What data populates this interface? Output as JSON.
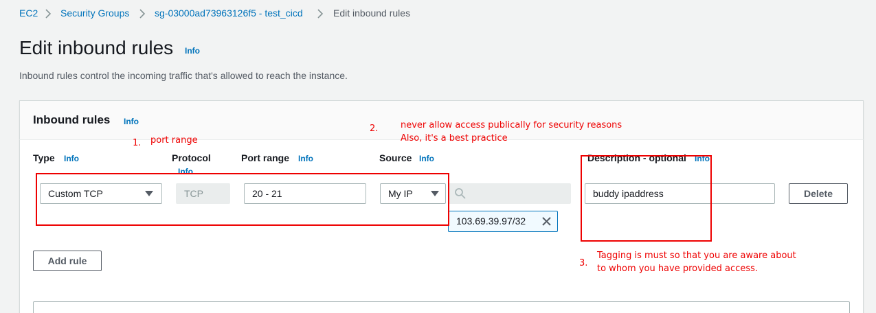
{
  "breadcrumb": {
    "items": [
      "EC2",
      "Security Groups",
      "sg-03000ad73963126f5 - test_cicd"
    ],
    "current": "Edit inbound rules"
  },
  "page": {
    "title": "Edit inbound rules",
    "info": "Info",
    "description": "Inbound rules control the incoming traffic that's allowed to reach the instance."
  },
  "panel": {
    "title": "Inbound rules",
    "info": "Info",
    "columns": {
      "type": "Type",
      "protocol": "Protocol",
      "port_range": "Port range",
      "source": "Source",
      "description": "Description - optional",
      "info": "Info"
    },
    "rule": {
      "type": "Custom TCP",
      "protocol": "TCP",
      "port_range": "20 - 21",
      "source_type": "My IP",
      "source_token": "103.69.39.97/32",
      "description": "buddy ipaddress",
      "delete_label": "Delete"
    },
    "add_rule_label": "Add rule"
  },
  "annotations": {
    "n1": "1.",
    "t1": "port range",
    "n2": "2.",
    "t2a": "never allow access publically for security reasons",
    "t2b": "Also, it's a best practice",
    "n3": "3.",
    "t3a": "Tagging is must so that you are aware about",
    "t3b": "to whom you have provided access.",
    "color": "#e00000"
  }
}
